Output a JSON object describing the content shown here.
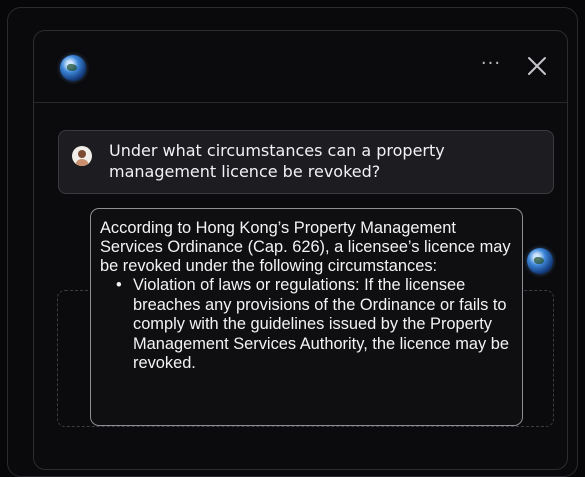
{
  "header": {
    "logo_icon": "globe-icon",
    "more_label": "···",
    "close_icon": "close-icon"
  },
  "user_message": {
    "avatar_icon": "user-avatar",
    "text": "Under what circumstances can a property management licence be revoked?"
  },
  "assistant_message": {
    "avatar_icon": "globe-icon",
    "intro": "According to Hong Kong’s Property Management Services Ordinance (Cap. 626), a licensee’s licence may be revoked under the following circumstances:",
    "items": [
      "Violation of laws or regulations: If the licensee breaches any provisions of the Ordinance or fails to comply with the guidelines issued by the Property Management Services Authority, the licence may be revoked."
    ]
  },
  "colors": {
    "background": "#070709",
    "panel": "#0b0b0d",
    "user_bubble": "#1d1d21",
    "answer_border": "#8e8e94",
    "text": "#f2f2f5"
  }
}
